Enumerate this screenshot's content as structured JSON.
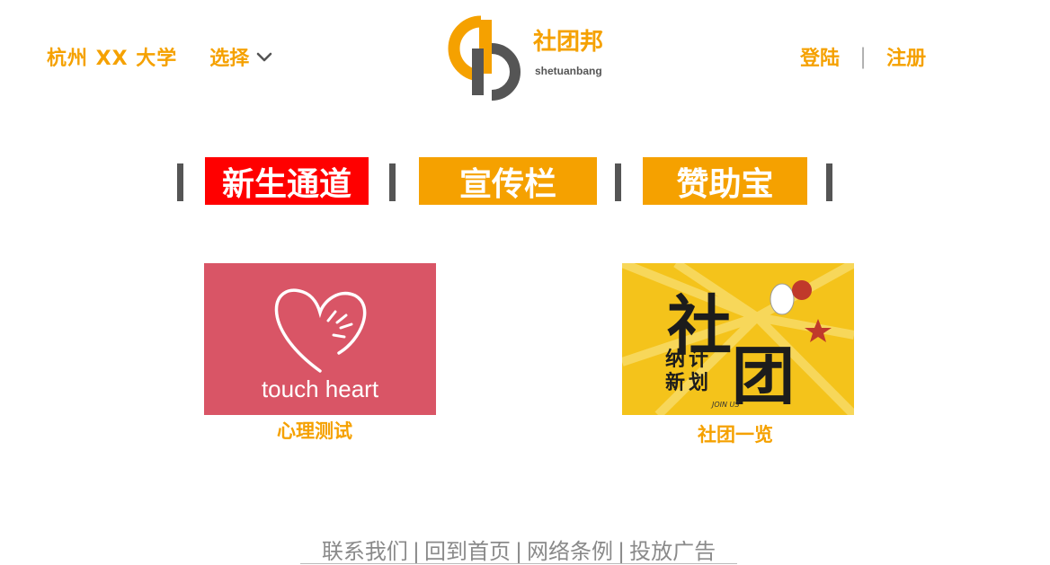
{
  "header": {
    "school": "杭州 XX 大学",
    "select_label": "选择",
    "logo": {
      "brand_cn": "社团邦",
      "brand_en": "shetuanbang"
    },
    "login_label": "登陆",
    "separator": "|",
    "register_label": "注册"
  },
  "nav": {
    "freshman": "新生通道",
    "board": "宣传栏",
    "sponsor": "赞助宝"
  },
  "cards": {
    "psych": {
      "image_text": "touch heart",
      "caption": "心理测试"
    },
    "clubs": {
      "image_text": [
        "社",
        "纳",
        "计",
        "新",
        "划",
        "团",
        "JOIN US"
      ],
      "caption": "社团一览"
    }
  },
  "footer": {
    "links": [
      "联系我们",
      "回到首页",
      "网络条例",
      "投放广告"
    ],
    "separator": "|"
  },
  "colors": {
    "accent": "#f5a100",
    "active_nav": "#ff0000",
    "nav": "#f5a100",
    "psych_bg": "#d95566",
    "clubs_bg": "#f4c31b",
    "footer_text": "#8a8a8a"
  }
}
